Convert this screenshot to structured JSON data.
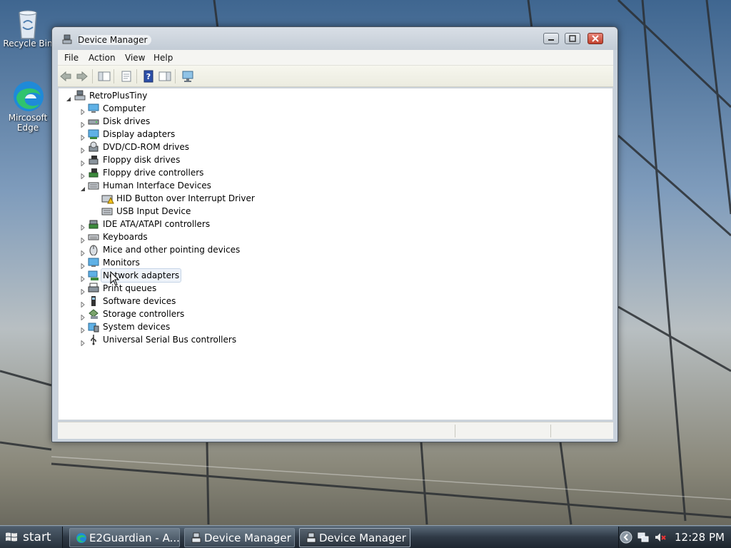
{
  "desktop": {
    "icons": [
      {
        "label": "Recycle Bin"
      },
      {
        "label": "Mircosoft Edge"
      }
    ]
  },
  "window": {
    "title": "Device Manager",
    "menu": [
      "File",
      "Action",
      "View",
      "Help"
    ],
    "tree": {
      "root": "RetroPlusTiny",
      "categories": [
        {
          "label": "Computer",
          "icon": "computer-icon",
          "expanded": false
        },
        {
          "label": "Disk drives",
          "icon": "disk-drive-icon",
          "expanded": false
        },
        {
          "label": "Display adapters",
          "icon": "display-adapter-icon",
          "expanded": false
        },
        {
          "label": "DVD/CD-ROM drives",
          "icon": "dvd-drive-icon",
          "expanded": false
        },
        {
          "label": "Floppy disk drives",
          "icon": "floppy-drive-icon",
          "expanded": false
        },
        {
          "label": "Floppy drive controllers",
          "icon": "floppy-controller-icon",
          "expanded": false
        },
        {
          "label": "Human Interface Devices",
          "icon": "hid-icon",
          "expanded": true,
          "children": [
            {
              "label": "HID Button over Interrupt Driver",
              "icon": "hid-warning-icon"
            },
            {
              "label": "USB Input Device",
              "icon": "hid-icon"
            }
          ]
        },
        {
          "label": "IDE ATA/ATAPI controllers",
          "icon": "ide-controller-icon",
          "expanded": false
        },
        {
          "label": "Keyboards",
          "icon": "keyboard-icon",
          "expanded": false
        },
        {
          "label": "Mice and other pointing devices",
          "icon": "mouse-icon",
          "expanded": false
        },
        {
          "label": "Monitors",
          "icon": "monitor-icon",
          "expanded": false
        },
        {
          "label": "Network adapters",
          "icon": "network-adapter-icon",
          "expanded": false
        },
        {
          "label": "Print queues",
          "icon": "printer-icon",
          "expanded": false
        },
        {
          "label": "Software devices",
          "icon": "software-device-icon",
          "expanded": false
        },
        {
          "label": "Storage controllers",
          "icon": "storage-controller-icon",
          "expanded": false
        },
        {
          "label": "System devices",
          "icon": "system-device-icon",
          "expanded": false
        },
        {
          "label": "Universal Serial Bus controllers",
          "icon": "usb-icon",
          "expanded": false
        }
      ]
    }
  },
  "taskbar": {
    "start_label": "start",
    "buttons": [
      {
        "label": "E2Guardian - A...",
        "icon": "edge-icon"
      },
      {
        "label": "Device Manager",
        "icon": "device-manager-icon"
      },
      {
        "label": "Device Manager",
        "icon": "device-manager-icon",
        "active": true
      }
    ],
    "clock": "12:28 PM"
  }
}
